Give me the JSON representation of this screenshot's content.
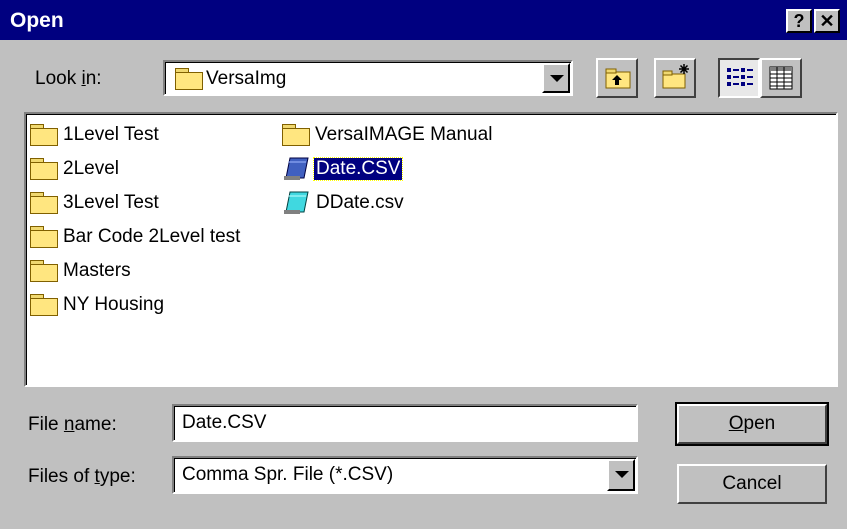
{
  "dialog": {
    "title": "Open",
    "help_label": "?",
    "close_label": "✕"
  },
  "look_in": {
    "label_pre": "Look ",
    "label_mnemonic": "i",
    "label_post": "n:",
    "value": "VersaImg"
  },
  "toolbar": {
    "up_one_level_icon": "up-folder-icon",
    "new_folder_icon": "new-folder-icon",
    "list_view_icon": "list-view-icon",
    "details_view_icon": "details-view-icon",
    "active_view": "list"
  },
  "files": [
    {
      "name": "1Level Test",
      "type": "folder",
      "selected": false
    },
    {
      "name": "2Level",
      "type": "folder",
      "selected": false
    },
    {
      "name": "3Level Test",
      "type": "folder",
      "selected": false
    },
    {
      "name": "Bar Code 2Level test",
      "type": "folder",
      "selected": false
    },
    {
      "name": "Masters",
      "type": "folder",
      "selected": false
    },
    {
      "name": "NY Housing",
      "type": "folder",
      "selected": false
    },
    {
      "name": "VersaIMAGE Manual",
      "type": "folder",
      "selected": false
    },
    {
      "name": "Date.CSV",
      "type": "file",
      "selected": true
    },
    {
      "name": "DDate.csv",
      "type": "file",
      "selected": false
    }
  ],
  "file_name": {
    "label_pre": "File ",
    "label_mnemonic": "n",
    "label_post": "ame:",
    "value": "Date.CSV"
  },
  "file_type": {
    "label_pre": "Files of ",
    "label_mnemonic": "t",
    "label_post": "ype:",
    "value": "Comma Spr. File (*.CSV)"
  },
  "buttons": {
    "open_mnemonic": "O",
    "open_rest": "pen",
    "cancel": "Cancel"
  },
  "colors": {
    "titlebar": "#000080",
    "face": "#c0c0c0",
    "selection": "#000080"
  }
}
